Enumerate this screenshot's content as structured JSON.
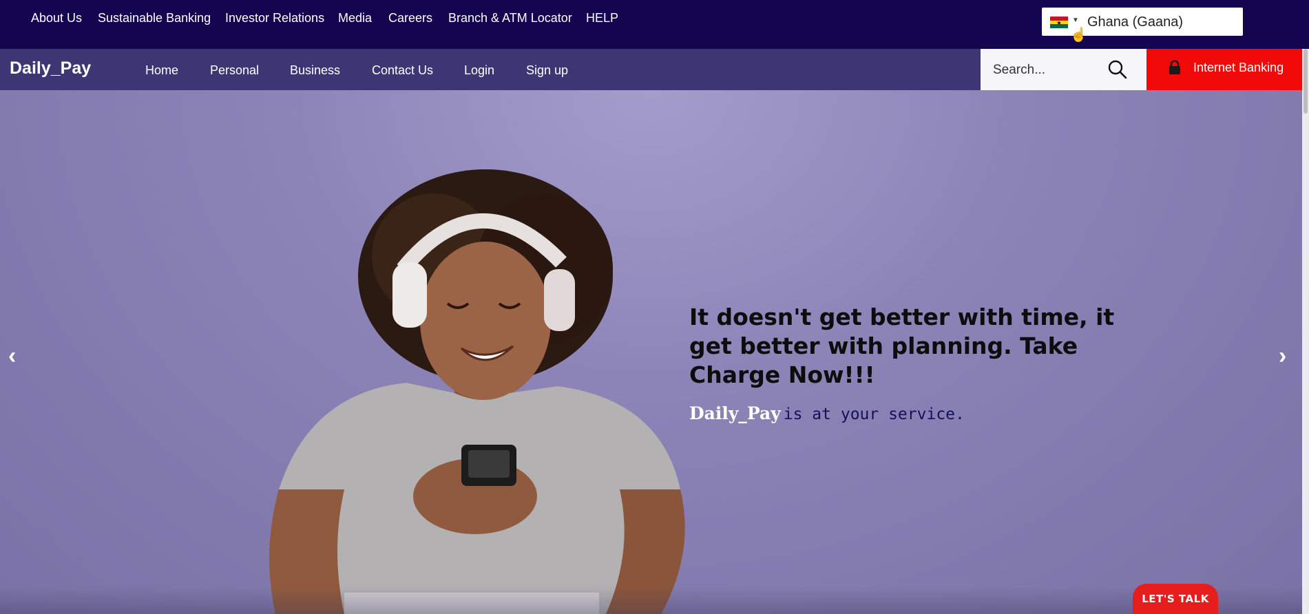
{
  "topbar": {
    "links": [
      {
        "label": "About Us"
      },
      {
        "label": "Sustainable Banking"
      },
      {
        "label": "Investor Relations"
      },
      {
        "label": "Media"
      },
      {
        "label": "Careers"
      },
      {
        "label": "Branch & ATM Locator"
      },
      {
        "label": "HELP"
      }
    ],
    "language": {
      "selected": "Ghana (Gaana)",
      "flag_icon": "ghana-flag-icon"
    }
  },
  "nav": {
    "brand": "Daily_Pay",
    "items": [
      {
        "label": "Home"
      },
      {
        "label": "Personal"
      },
      {
        "label": "Business"
      },
      {
        "label": "Contact Us"
      },
      {
        "label": "Login"
      },
      {
        "label": "Sign up"
      }
    ],
    "search": {
      "placeholder": "Search...",
      "icon": "search-icon"
    },
    "internet_banking": {
      "label": "Internet Banking",
      "icon": "lock-icon"
    }
  },
  "hero": {
    "heading": "It doesn't get better with time, it get better with planning. Take Charge Now!!!",
    "sub_brand": "Daily_Pay",
    "sub_text": "is at your service.",
    "prev_arrow": "‹",
    "next_arrow": "›",
    "chat_button": "LET'S TALK"
  },
  "colors": {
    "topbar_bg": "#13054f",
    "nav_bg": "#3c3774",
    "accent_red": "#f20909",
    "hero_bg": "#8c84b7"
  }
}
